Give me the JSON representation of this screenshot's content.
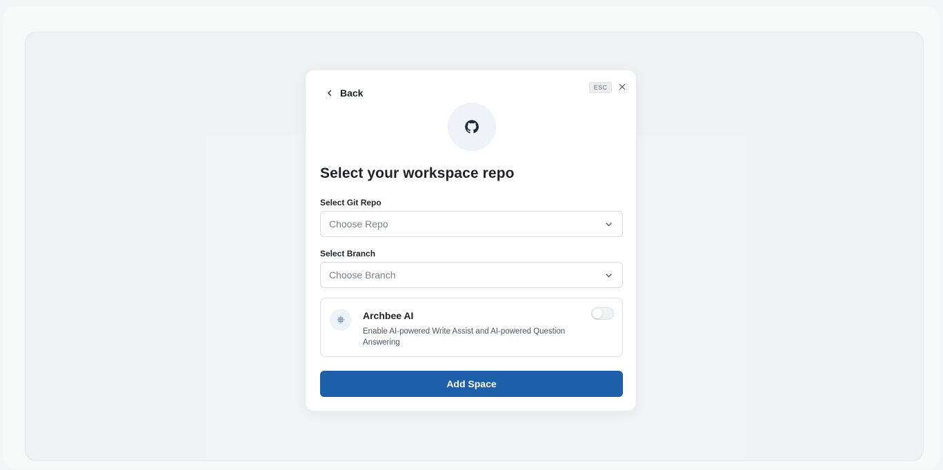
{
  "modal": {
    "back_label": "Back",
    "esc_label": "ESC",
    "logo_icon": "github-icon",
    "title": "Select your workspace repo",
    "repo_field": {
      "label": "Select Git Repo",
      "placeholder": "Choose Repo"
    },
    "branch_field": {
      "label": "Select Branch",
      "placeholder": "Choose Branch"
    },
    "ai_card": {
      "icon": "sparkle-icon",
      "title": "Archbee AI",
      "description": "Enable AI-powered Write Assist and AI-powered Question Answering",
      "enabled": false
    },
    "submit_label": "Add Space"
  },
  "colors": {
    "accent": "#1d5fa8",
    "background": "#eff1f3",
    "modal": "#ffffff"
  }
}
